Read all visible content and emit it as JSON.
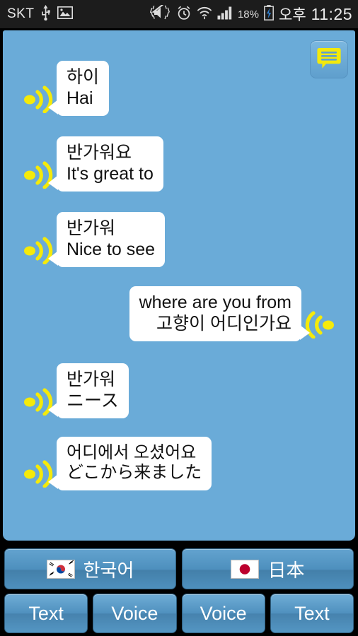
{
  "statusbar": {
    "carrier": "SKT",
    "battery_percent": "18%",
    "ampm": "오후",
    "time": "11:25",
    "icons": [
      "usb-icon",
      "image-icon",
      "mute-vibrate-icon",
      "alarm-icon",
      "wifi-icon",
      "signal-icon",
      "battery-charging-icon"
    ]
  },
  "header": {
    "compose_icon": "chat-bubble-icon"
  },
  "colors": {
    "panel_blue": "#6aabd8",
    "bubble_white": "#ffffff",
    "speaker_yellow": "#f5ea0a",
    "button_blue": "#4f90be",
    "statusbar_black": "#1c1c1c",
    "text_dark": "#111111"
  },
  "messages": [
    {
      "side": "left",
      "speaker_icon": "speaker-wave-right-icon",
      "line1": "하이",
      "line2": "Hai"
    },
    {
      "side": "left",
      "speaker_icon": "speaker-wave-right-icon",
      "line1": "반가워요",
      "line2": "It's great to"
    },
    {
      "side": "left",
      "speaker_icon": "speaker-wave-right-icon",
      "line1": "반가워",
      "line2": "Nice to see"
    },
    {
      "side": "right",
      "speaker_icon": "speaker-wave-left-icon",
      "line1": "where are you from",
      "line2": "고향이 어디인가요"
    },
    {
      "side": "left",
      "speaker_icon": "speaker-wave-right-icon",
      "line1": "반가워",
      "line2": "ニース"
    },
    {
      "side": "left",
      "speaker_icon": "speaker-wave-right-icon",
      "line1": "어디에서 오셨어요",
      "line2": "どこから来ました"
    }
  ],
  "language_bar": [
    {
      "flag": "korea-flag-icon",
      "label": "한국어"
    },
    {
      "flag": "japan-flag-icon",
      "label": "日本"
    }
  ],
  "action_bar": [
    {
      "label": "Text"
    },
    {
      "label": "Voice"
    },
    {
      "label": "Voice"
    },
    {
      "label": "Text"
    }
  ]
}
